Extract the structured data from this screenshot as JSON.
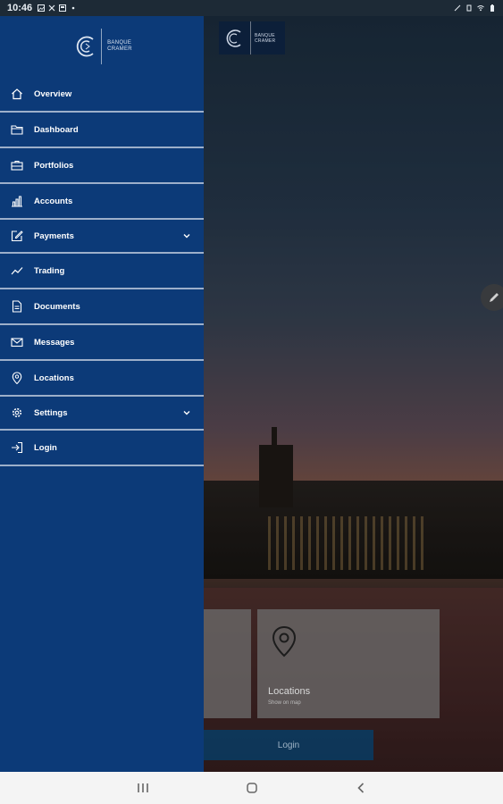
{
  "status_bar": {
    "time": "10:46"
  },
  "brand": {
    "line1": "BANQUE",
    "line2": "CRAMER"
  },
  "drawer": {
    "items": [
      {
        "label": "Overview",
        "icon": "home-icon"
      },
      {
        "label": "Dashboard",
        "icon": "folder-icon"
      },
      {
        "label": "Portfolios",
        "icon": "briefcase-icon"
      },
      {
        "label": "Accounts",
        "icon": "bar-chart-icon"
      },
      {
        "label": "Payments",
        "icon": "edit-square-icon",
        "expandable": true
      },
      {
        "label": "Trading",
        "icon": "trend-icon"
      },
      {
        "label": "Documents",
        "icon": "document-icon"
      },
      {
        "label": "Messages",
        "icon": "envelope-icon"
      },
      {
        "label": "Locations",
        "icon": "map-pin-icon"
      },
      {
        "label": "Settings",
        "icon": "gear-icon",
        "expandable": true
      },
      {
        "label": "Login",
        "icon": "sign-in-icon"
      }
    ]
  },
  "tiles": {
    "locations": {
      "title": "Locations",
      "subtitle": "Show on map"
    }
  },
  "login_button": {
    "label": "Login"
  },
  "colors": {
    "drawer_bg": "#0c3a78",
    "accent": "#083c64"
  }
}
